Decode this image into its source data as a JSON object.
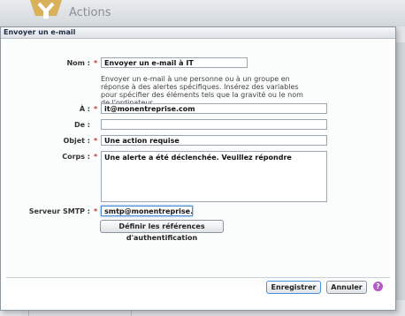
{
  "app": {
    "section_title": "Actions"
  },
  "dialog": {
    "title": "Envoyer un e-mail",
    "fields": {
      "nom": {
        "label": "Nom :",
        "value": "Envoyer un e-mail à IT"
      },
      "description": "Envoyer un e-mail à une personne ou à un groupe en réponse à des alertes spécifiques.  Insérez des variables pour spécifier des éléments tels que la gravité ou le nom de l'ordinateur.",
      "a": {
        "label": "À :",
        "value": "it@monentreprise.com"
      },
      "de": {
        "label": "De :",
        "value": ""
      },
      "objet": {
        "label": "Objet :",
        "value": "Une action requise"
      },
      "corps": {
        "label": "Corps :",
        "value": "Une alerte a été déclenchée.  Veuillez répondre"
      },
      "smtp": {
        "label": "Serveur SMTP :",
        "value": "smtp@monentreprise.com"
      }
    },
    "required_marker": "*",
    "auth_button": "Définir les références d'authentification",
    "save_button": "Enregistrer",
    "cancel_button": "Annuler",
    "help_icon_glyph": "?"
  },
  "colors": {
    "required": "#cc3333",
    "help": "#b25bc4",
    "focus": "#4d8fd6"
  }
}
